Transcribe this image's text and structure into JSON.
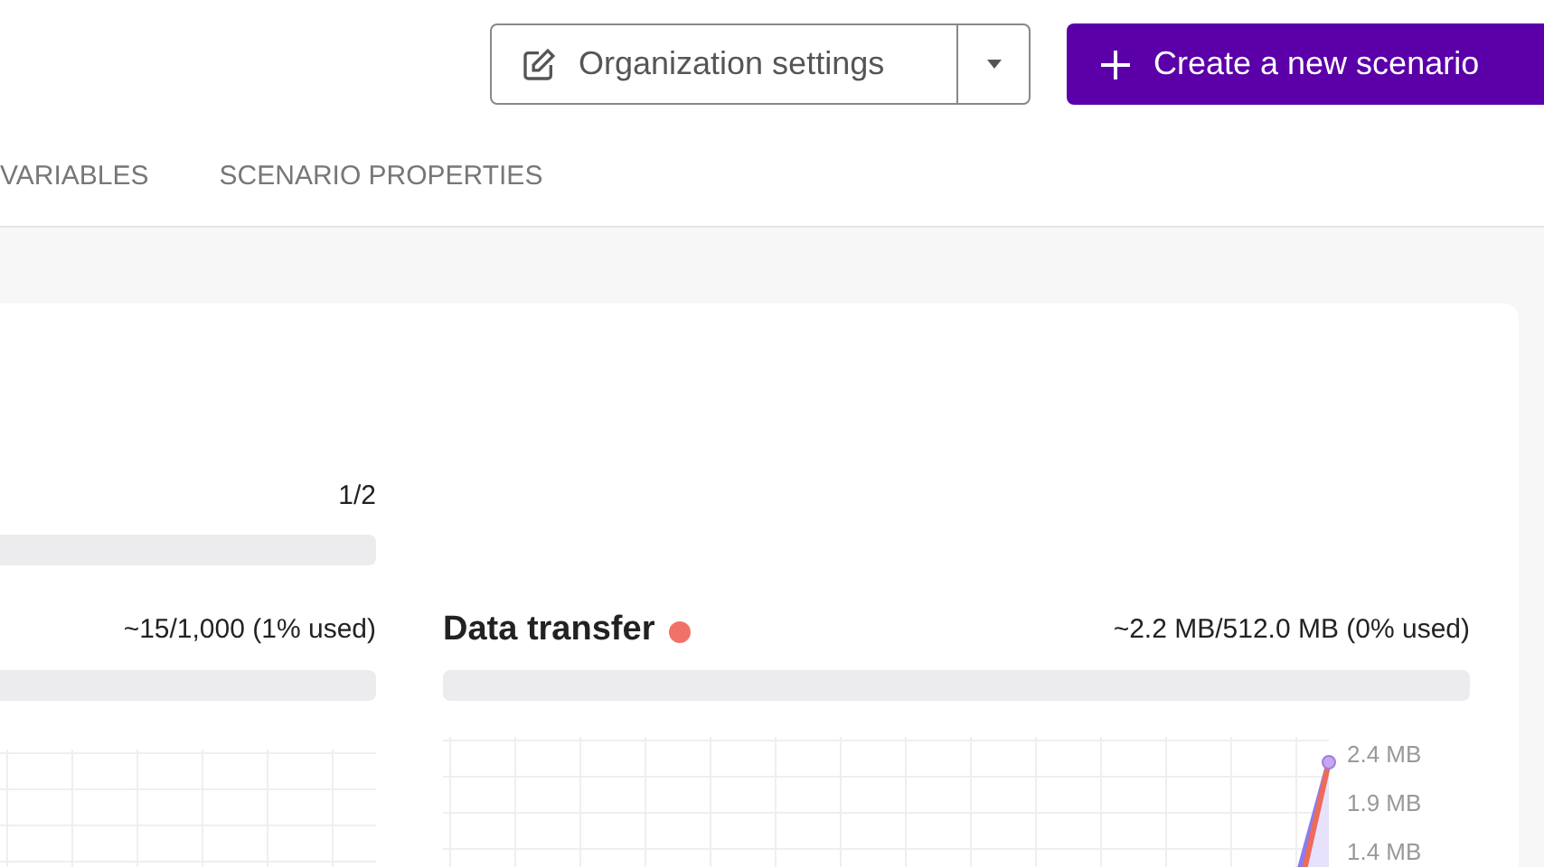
{
  "header": {
    "settings_button": "Organization settings",
    "create_button": "Create a new scenario"
  },
  "tabs": [
    {
      "label": "VARIABLES",
      "selected": false
    },
    {
      "label": "SCENARIO PROPERTIES",
      "selected": false
    }
  ],
  "usage": {
    "first_row": {
      "reading": "1/2"
    },
    "second_row": [
      {
        "reading": "~15/1,000 (1% used)"
      },
      {
        "title": "Data transfer",
        "color": "#f07167",
        "reading": "~2.2 MB/512.0 MB (0% used)",
        "y_ticks": [
          "2.4 MB",
          "1.9 MB",
          "1.4 MB"
        ]
      }
    ]
  }
}
